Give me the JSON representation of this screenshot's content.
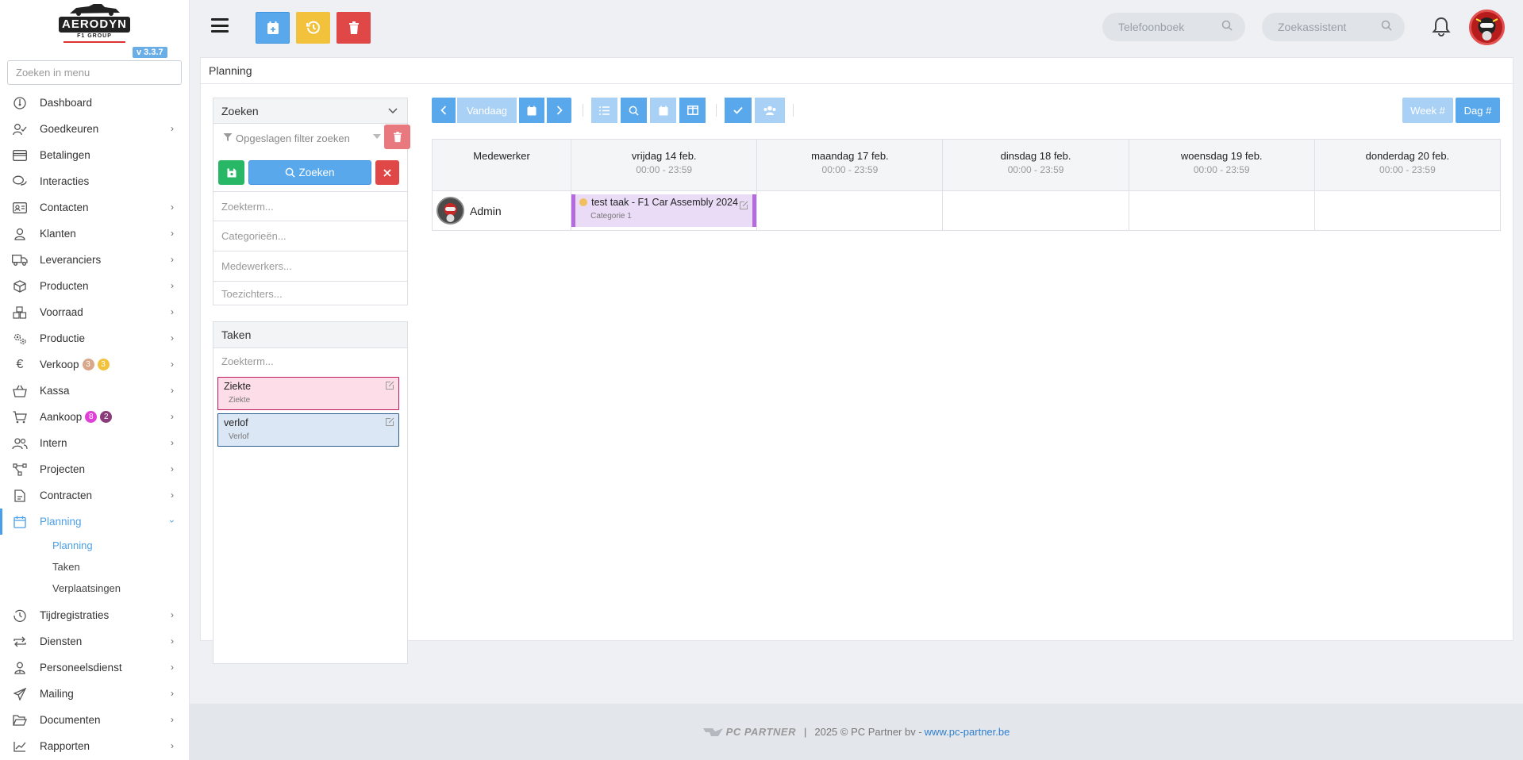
{
  "app": {
    "version": "v 3.3.7",
    "logo_text": "AERODYN",
    "logo_sub": "F1 GROUP"
  },
  "sidebar": {
    "search_placeholder": "Zoeken in menu",
    "items": [
      {
        "label": "Dashboard",
        "icon": "dashboard-icon",
        "chevron": false
      },
      {
        "label": "Goedkeuren",
        "icon": "user-check-icon",
        "chevron": true
      },
      {
        "label": "Betalingen",
        "icon": "credit-card-icon",
        "chevron": false
      },
      {
        "label": "Interacties",
        "icon": "chat-icon",
        "chevron": false
      },
      {
        "label": "Contacten",
        "icon": "address-card-icon",
        "chevron": true
      },
      {
        "label": "Klanten",
        "icon": "user-icon",
        "chevron": true
      },
      {
        "label": "Leveranciers",
        "icon": "truck-icon",
        "chevron": true
      },
      {
        "label": "Producten",
        "icon": "box-icon",
        "chevron": true
      },
      {
        "label": "Voorraad",
        "icon": "boxes-icon",
        "chevron": true
      },
      {
        "label": "Productie",
        "icon": "gears-icon",
        "chevron": true
      },
      {
        "label": "Verkoop",
        "icon": "euro-icon",
        "chevron": true
      },
      {
        "label": "Kassa",
        "icon": "basket-icon",
        "chevron": true
      },
      {
        "label": "Aankoop",
        "icon": "cart-icon",
        "chevron": true
      },
      {
        "label": "Intern",
        "icon": "users-icon",
        "chevron": true
      },
      {
        "label": "Projecten",
        "icon": "project-diagram-icon",
        "chevron": true
      },
      {
        "label": "Contracten",
        "icon": "contract-icon",
        "chevron": true
      },
      {
        "label": "Planning",
        "icon": "calendar-icon",
        "chevron": true
      },
      {
        "label": "Tijdregistraties",
        "icon": "clock-history-icon",
        "chevron": true
      },
      {
        "label": "Diensten",
        "icon": "repeat-icon",
        "chevron": true
      },
      {
        "label": "Personeelsdienst",
        "icon": "user-tie-icon",
        "chevron": true
      },
      {
        "label": "Mailing",
        "icon": "paper-plane-icon",
        "chevron": true
      },
      {
        "label": "Documenten",
        "icon": "folder-open-icon",
        "chevron": true
      },
      {
        "label": "Rapporten",
        "icon": "chart-line-icon",
        "chevron": true
      }
    ],
    "verkoop_badges": [
      "3",
      "3"
    ],
    "aankoop_badges": [
      "8",
      "2"
    ],
    "planning_sub": [
      "Planning",
      "Taken",
      "Verplaatsingen"
    ],
    "colors": {
      "active": "#4a9fe8",
      "badge_tan": "#d9a88a",
      "badge_yellow": "#f2c23c",
      "badge_magenta": "#e040d8",
      "badge_purple": "#8a3d7a"
    }
  },
  "topbar": {
    "phonebook_placeholder": "Telefoonboek",
    "assistant_placeholder": "Zoekassistent",
    "buttons": [
      {
        "name": "new-appointment",
        "color": "#5aa8ec"
      },
      {
        "name": "history",
        "color": "#f2c23c"
      },
      {
        "name": "delete",
        "color": "#e04848"
      }
    ]
  },
  "page": {
    "title": "Planning"
  },
  "filters": {
    "header": "Zoeken",
    "saved_filter_placeholder": "Opgeslagen filter zoeken",
    "search_button": "Zoeken",
    "fields": [
      "Zoekterm...",
      "Categorieën...",
      "Medewerkers...",
      "Toezichters..."
    ]
  },
  "tasks": {
    "header": "Taken",
    "search_placeholder": "Zoekterm...",
    "items": [
      {
        "title": "Ziekte",
        "category": "Ziekte",
        "bg": "#fcdde8",
        "border": "#c2185b"
      },
      {
        "title": "verlof",
        "category": "Verlof",
        "bg": "#dce7f5",
        "border": "#2c5d8f"
      }
    ]
  },
  "calendar": {
    "today_label": "Vandaag",
    "week_label": "Week #",
    "day_label": "Dag #",
    "employee_header": "Medewerker",
    "days": [
      {
        "date": "vrijdag 14 feb.",
        "hours": "00:00 - 23:59"
      },
      {
        "date": "maandag 17 feb.",
        "hours": "00:00 - 23:59"
      },
      {
        "date": "dinsdag 18 feb.",
        "hours": "00:00 - 23:59"
      },
      {
        "date": "woensdag 19 feb.",
        "hours": "00:00 - 23:59"
      },
      {
        "date": "donderdag 20 feb.",
        "hours": "00:00 - 23:59"
      }
    ],
    "rows": [
      {
        "employee": "Admin",
        "event": {
          "title": "test taak - F1 Car Assembly 2024",
          "category": "Categorie 1",
          "day": 0
        }
      }
    ]
  },
  "footer": {
    "brand": "PC PARTNER",
    "sep": "|",
    "copyright": "2025 © PC Partner bv - ",
    "link": "www.pc-partner.be"
  }
}
